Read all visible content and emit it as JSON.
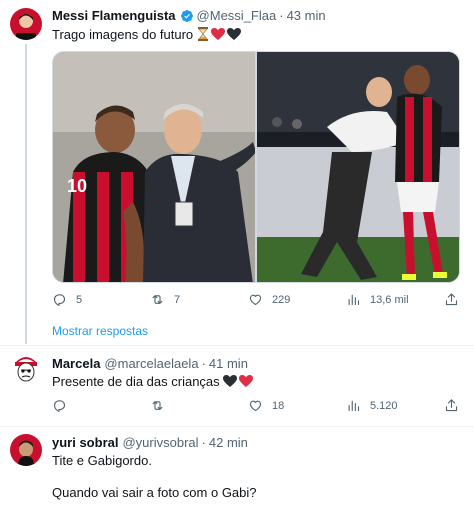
{
  "main_tweet": {
    "name": "Messi Flamenguista",
    "handle": "@Messi_Flaa",
    "time": "43 min",
    "text": "Trago imagens do futuro",
    "emojis": "⏳❤️🖤",
    "replies": "5",
    "retweets": "7",
    "likes": "229",
    "views": "13,6 mil",
    "show_replies": "Mostrar respostas"
  },
  "replies": [
    {
      "name": "Marcela",
      "handle": "@marcelaelaela",
      "time": "41 min",
      "text": "Presente de dia das crianças",
      "emojis": "🖤❤️",
      "replies": "",
      "retweets": "",
      "likes": "18",
      "views": "5.120"
    },
    {
      "name": "yuri sobral",
      "handle": "@yurivsobral",
      "time": "42 min",
      "text_line1": "Tite e Gabigordo.",
      "text_line2": "Quando vai sair a foto com o Gabi?"
    }
  ],
  "colors": {
    "accent": "#1d9bf0",
    "verified": "#1d9bf0",
    "secondary_text": "#536471",
    "divider": "#eff3f4"
  },
  "icons": [
    "verified-badge-icon",
    "reply-icon",
    "retweet-icon",
    "like-icon",
    "views-icon",
    "share-icon"
  ]
}
